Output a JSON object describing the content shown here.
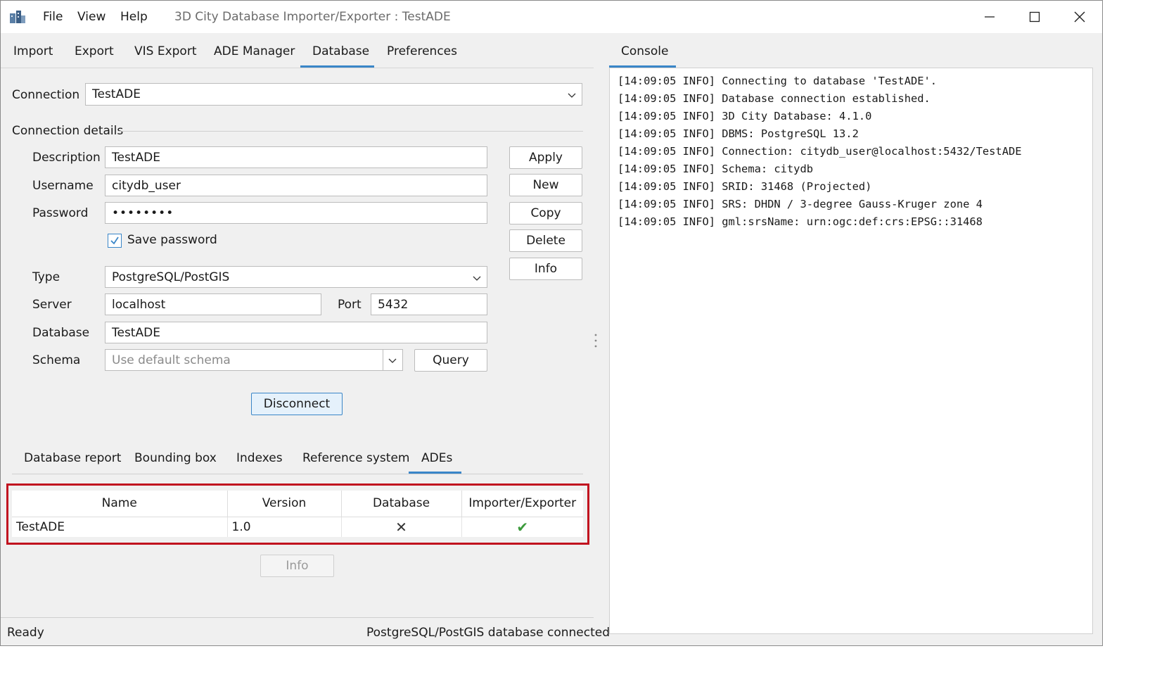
{
  "menu": [
    "File",
    "View",
    "Help"
  ],
  "window_title": "3D City Database Importer/Exporter : TestADE",
  "tabs": [
    "Import",
    "Export",
    "VIS Export",
    "ADE Manager",
    "Database",
    "Preferences"
  ],
  "active_tab": "Database",
  "console_tab": "Console",
  "connection": {
    "label": "Connection",
    "value": "TestADE"
  },
  "details": {
    "heading": "Connection details",
    "description": {
      "label": "Description",
      "value": "TestADE"
    },
    "username": {
      "label": "Username",
      "value": "citydb_user"
    },
    "password": {
      "label": "Password",
      "value": "••••••••"
    },
    "save_password": {
      "label": "Save password",
      "checked": true
    },
    "type": {
      "label": "Type",
      "value": "PostgreSQL/PostGIS"
    },
    "server": {
      "label": "Server",
      "value": "localhost"
    },
    "port": {
      "label": "Port",
      "value": "5432"
    },
    "database": {
      "label": "Database",
      "value": "TestADE"
    },
    "schema": {
      "label": "Schema",
      "placeholder": "Use default schema"
    },
    "query_button": "Query"
  },
  "side_buttons": [
    "Apply",
    "New",
    "Copy",
    "Delete",
    "Info"
  ],
  "disconnect_button": "Disconnect",
  "subtabs": [
    "Database report",
    "Bounding box",
    "Indexes",
    "Reference system",
    "ADEs"
  ],
  "active_subtab": "ADEs",
  "ade_table": {
    "columns": [
      "Name",
      "Version",
      "Database",
      "Importer/Exporter"
    ],
    "rows": [
      {
        "name": "TestADE",
        "version": "1.0",
        "database": "✕",
        "importer_exporter": "✔"
      }
    ]
  },
  "info_button": "Info",
  "status": {
    "left": "Ready",
    "right": "PostgreSQL/PostGIS database connected"
  },
  "console_lines": [
    "[14:09:05 INFO] Connecting to database 'TestADE'.",
    "[14:09:05 INFO] Database connection established.",
    "[14:09:05 INFO] 3D City Database: 4.1.0",
    "[14:09:05 INFO] DBMS: PostgreSQL 13.2",
    "[14:09:05 INFO] Connection: citydb_user@localhost:5432/TestADE",
    "[14:09:05 INFO] Schema: citydb",
    "[14:09:05 INFO] SRID: 31468 (Projected)",
    "[14:09:05 INFO] SRS: DHDN / 3-degree Gauss-Kruger zone 4",
    "[14:09:05 INFO] gml:srsName: urn:ogc:def:crs:EPSG::31468"
  ],
  "colors": {
    "accent": "#3a86c8",
    "highlight": "#c1121f",
    "check": "#3c9a3c"
  }
}
